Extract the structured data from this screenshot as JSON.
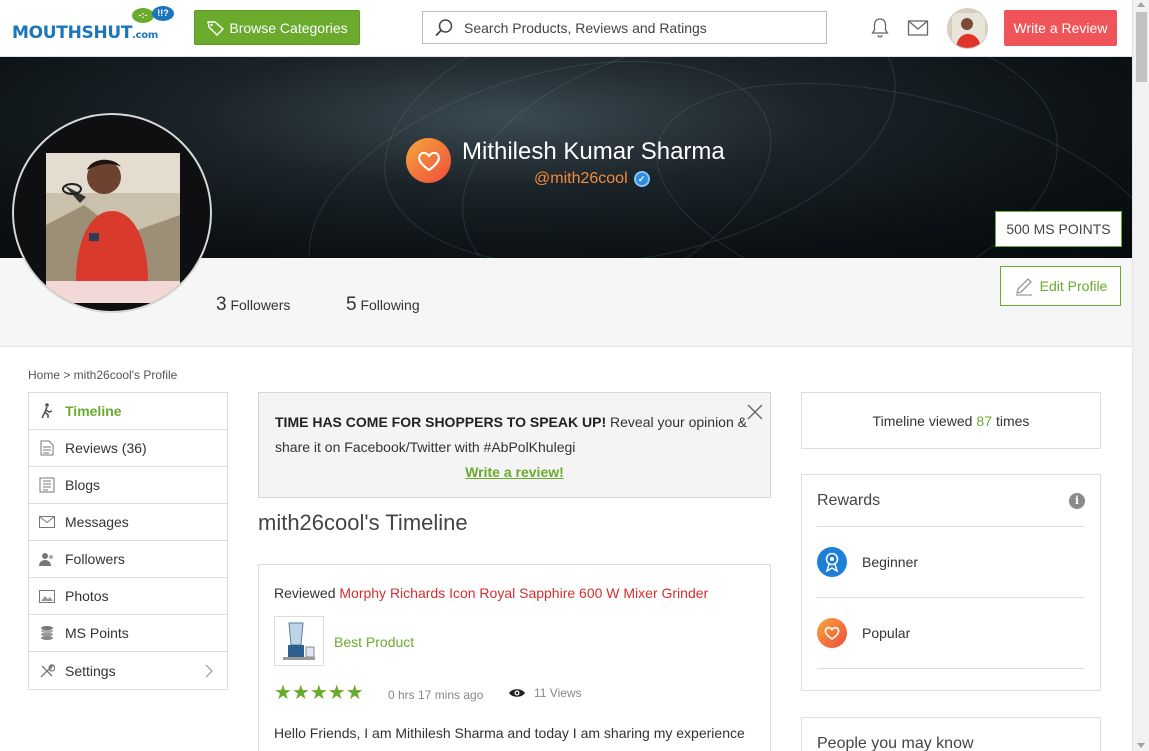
{
  "header": {
    "logo_text": "MOUTHSHUT",
    "logo_suffix": ".com",
    "logo_bubble_left": "-:-",
    "logo_bubble_right": "!!?",
    "browse_label": "Browse Categories",
    "search_placeholder": "Search Products, Reviews and Ratings",
    "write_review_label": "Write a Review"
  },
  "profile": {
    "name": "Mithilesh Kumar Sharma",
    "handle": "@mith26cool",
    "points_label": "500 MS POINTS",
    "followers_count": "3",
    "followers_label": "Followers",
    "following_count": "5",
    "following_label": "Following",
    "edit_label": "Edit Profile"
  },
  "breadcrumb": "Home > mith26cool's Profile",
  "sidenav": {
    "items": [
      {
        "label": "Timeline",
        "icon": "walker-icon"
      },
      {
        "label": "Reviews (36)",
        "icon": "document-icon"
      },
      {
        "label": "Blogs",
        "icon": "blog-icon"
      },
      {
        "label": "Messages",
        "icon": "envelope-icon"
      },
      {
        "label": "Followers",
        "icon": "followers-icon"
      },
      {
        "label": "Photos",
        "icon": "photo-icon"
      },
      {
        "label": "MS Points",
        "icon": "coins-icon"
      },
      {
        "label": "Settings",
        "icon": "tools-icon"
      }
    ]
  },
  "promo": {
    "headline": "TIME HAS COME FOR SHOPPERS TO SPEAK UP!",
    "text": " Reveal your opinion & share it on Facebook/Twitter with #AbPolKhulegi",
    "link": "Write a review!"
  },
  "timeline": {
    "title": "mith26cool's Timeline",
    "card": {
      "prefix": "Reviewed ",
      "product": "Morphy Richards Icon Royal Sapphire 600 W Mixer Grinder",
      "headline": "Best Product",
      "rating": 5,
      "stars": "★★★★★",
      "time": "0 hrs 17 mins ago",
      "views": "11 Views",
      "text": "Hello Friends, I am Mithilesh Sharma and today I am sharing my experience"
    }
  },
  "right": {
    "viewed_prefix": "Timeline viewed",
    "viewed_count": "87",
    "viewed_suffix": "times",
    "rewards_title": "Rewards",
    "rewards": [
      {
        "label": "Beginner",
        "color": "#1e7fd6"
      },
      {
        "label": "Popular",
        "color": "#ef5a3c"
      }
    ],
    "people_title": "People you may know"
  },
  "colors": {
    "brand_green": "#6aaa2d",
    "brand_red": "#ef5558",
    "product_link": "#d32f2f",
    "handle_orange": "#f28b3c"
  }
}
